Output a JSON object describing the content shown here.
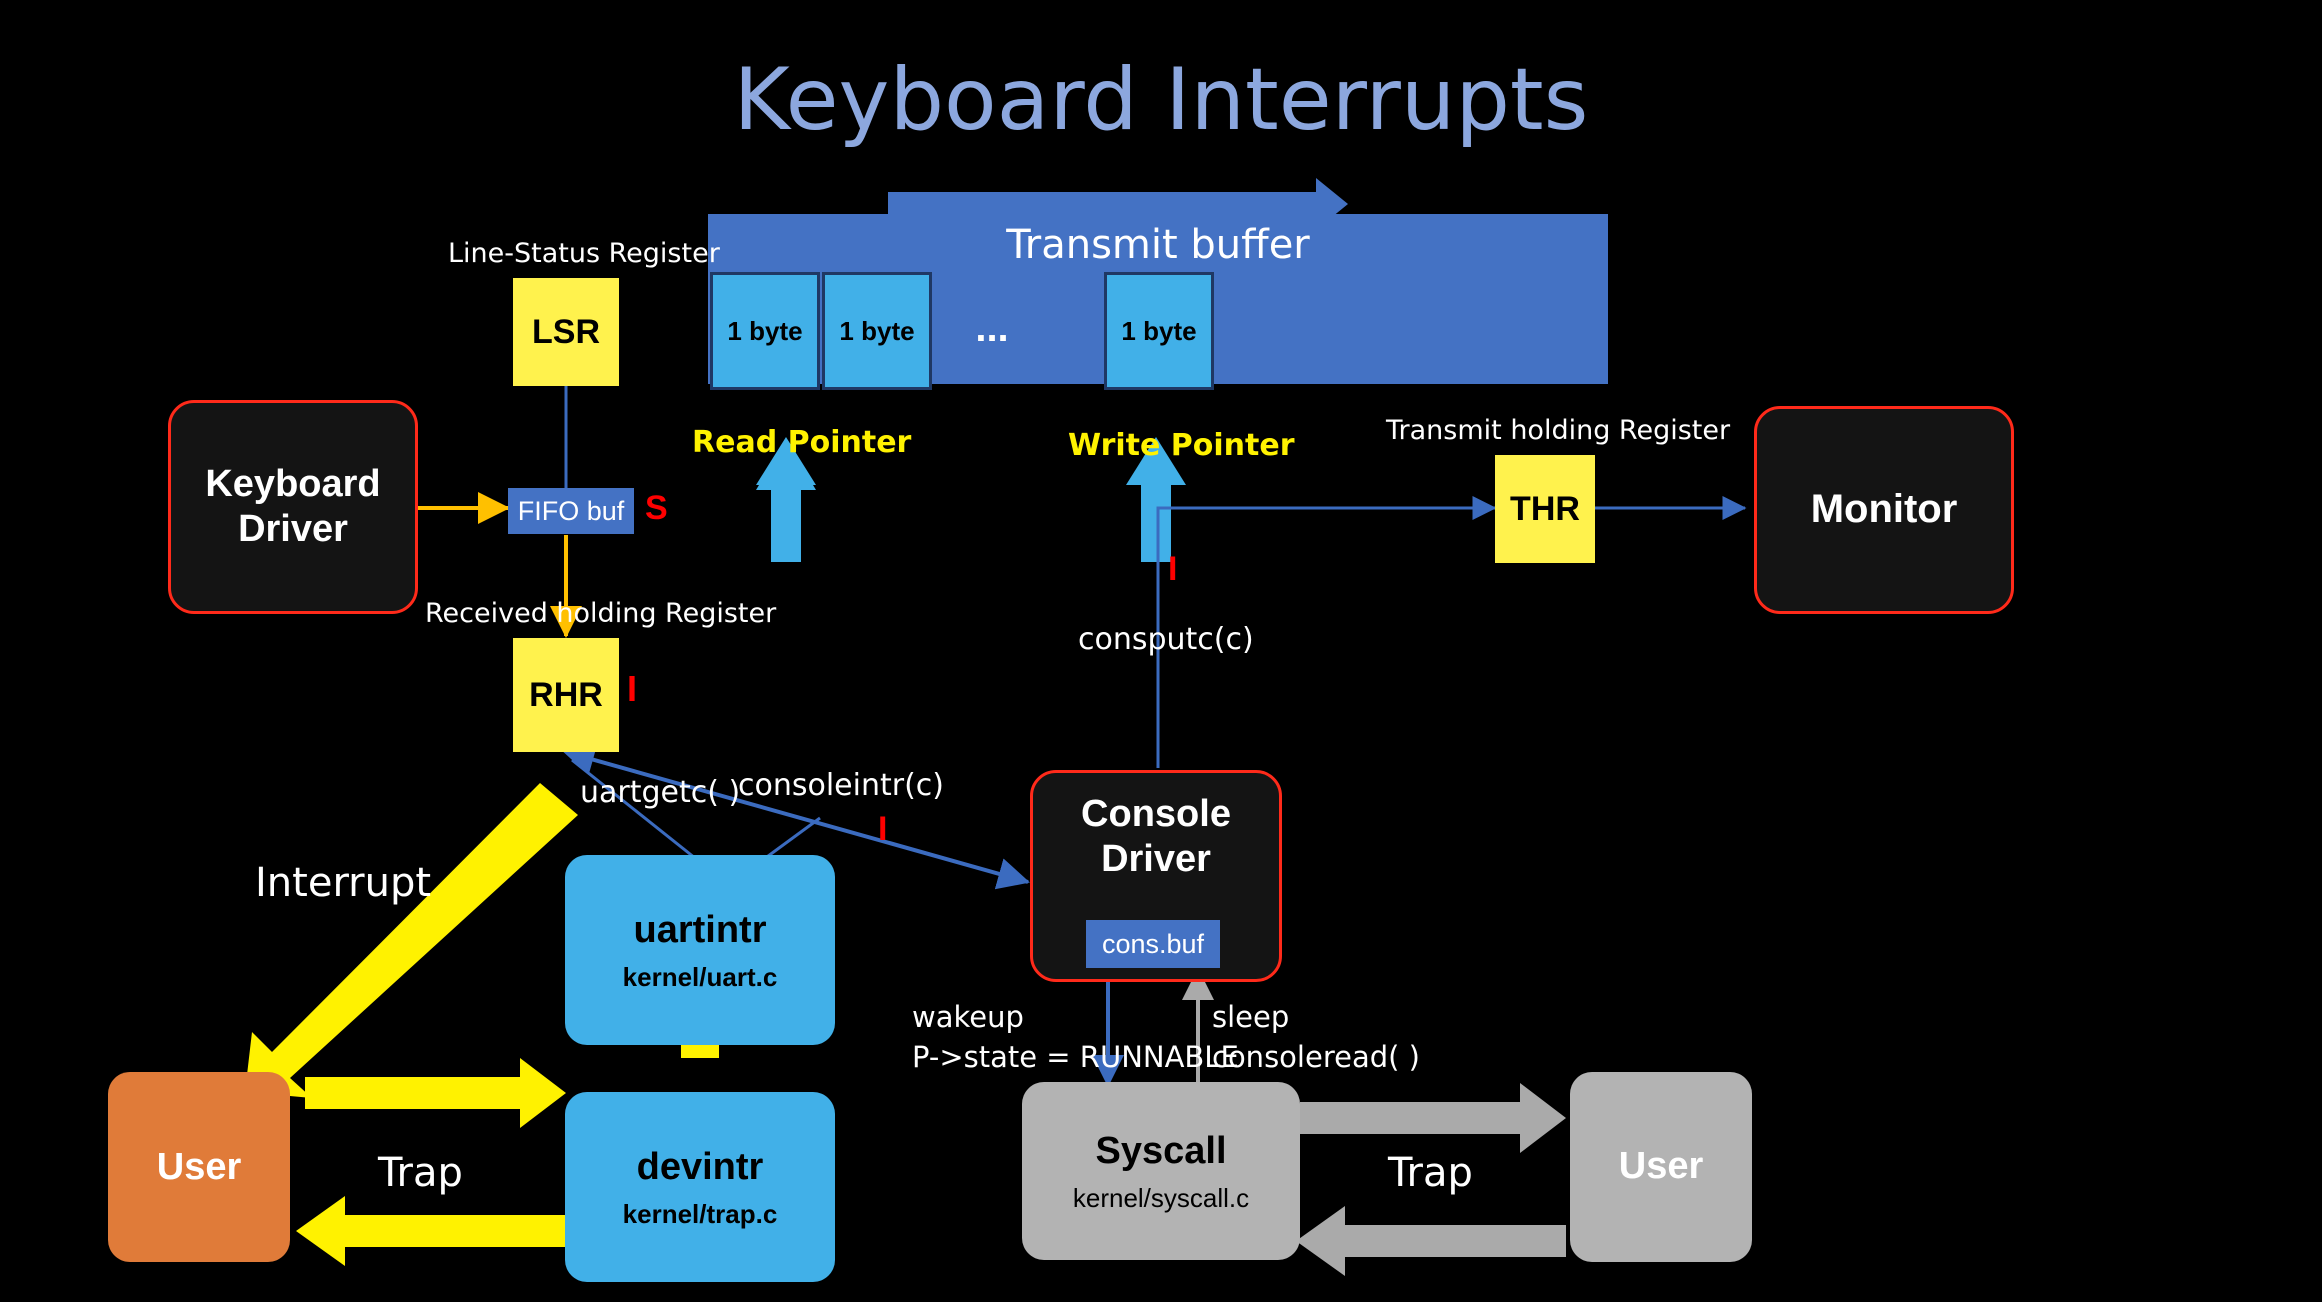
{
  "title": "Keyboard Interrupts",
  "title_color": "#8CA7DE",
  "colors": {
    "background": "#000000",
    "register_yellow": "#FFF24D",
    "buffer_blue": "#4472C4",
    "byte_cyan": "#41B0E8",
    "box_border_red": "#FF2A1A",
    "pointer_yellow": "#FFF200",
    "interrupt_yellow": "#FFF200",
    "user_orange": "#E07B39",
    "syscall_gray": "#B3B3B3",
    "arrow_blue": "#4472C4",
    "arrow_orange": "#FFC000",
    "red_mark": "#FF0000"
  },
  "transmit_buffer": {
    "title": "Transmit buffer",
    "direction_arrow": "right",
    "cells": [
      {
        "label": "1 byte"
      },
      {
        "label": "1 byte"
      },
      {
        "label": "..."
      },
      {
        "label": "1 byte"
      }
    ],
    "read_pointer_label": "Read Pointer",
    "write_pointer_label": "Write Pointer"
  },
  "registers": {
    "lsr": {
      "caption": "Line-Status Register",
      "label": "LSR"
    },
    "rhr": {
      "caption": "Received holding Register",
      "label": "RHR",
      "mark": "I"
    },
    "thr": {
      "caption": "Transmit holding Register",
      "label": "THR"
    }
  },
  "nodes": {
    "keyboard_driver": {
      "label": "Keyboard\nDriver"
    },
    "monitor": {
      "label": "Monitor"
    },
    "console_driver": {
      "label": "Console\nDriver",
      "buffer_label": "cons.buf"
    },
    "uartintr": {
      "label": "uartintr",
      "sub": "kernel/uart.c"
    },
    "devintr": {
      "label": "devintr",
      "sub": "kernel/trap.c"
    },
    "syscall": {
      "label": "Syscall",
      "sub": "kernel/syscall.c"
    },
    "user_left": {
      "label": "User"
    },
    "user_right": {
      "label": "User"
    },
    "fifo_buf": {
      "label": "FIFO buf",
      "mark": "S"
    }
  },
  "edge_labels": {
    "interrupt": "Interrupt",
    "trap_left": "Trap",
    "trap_right": "Trap",
    "uartgetc": "uartgetc( )",
    "consoleintr": "consoleintr(c)",
    "consoleintr_mark": "I",
    "consputc": "consputc(c)",
    "consputc_mark": "I",
    "wakeup_line1": "wakeup",
    "wakeup_line2": "P->state = RUNNABLE",
    "sleep_line1": "sleep",
    "sleep_line2": "consoleread( )"
  }
}
